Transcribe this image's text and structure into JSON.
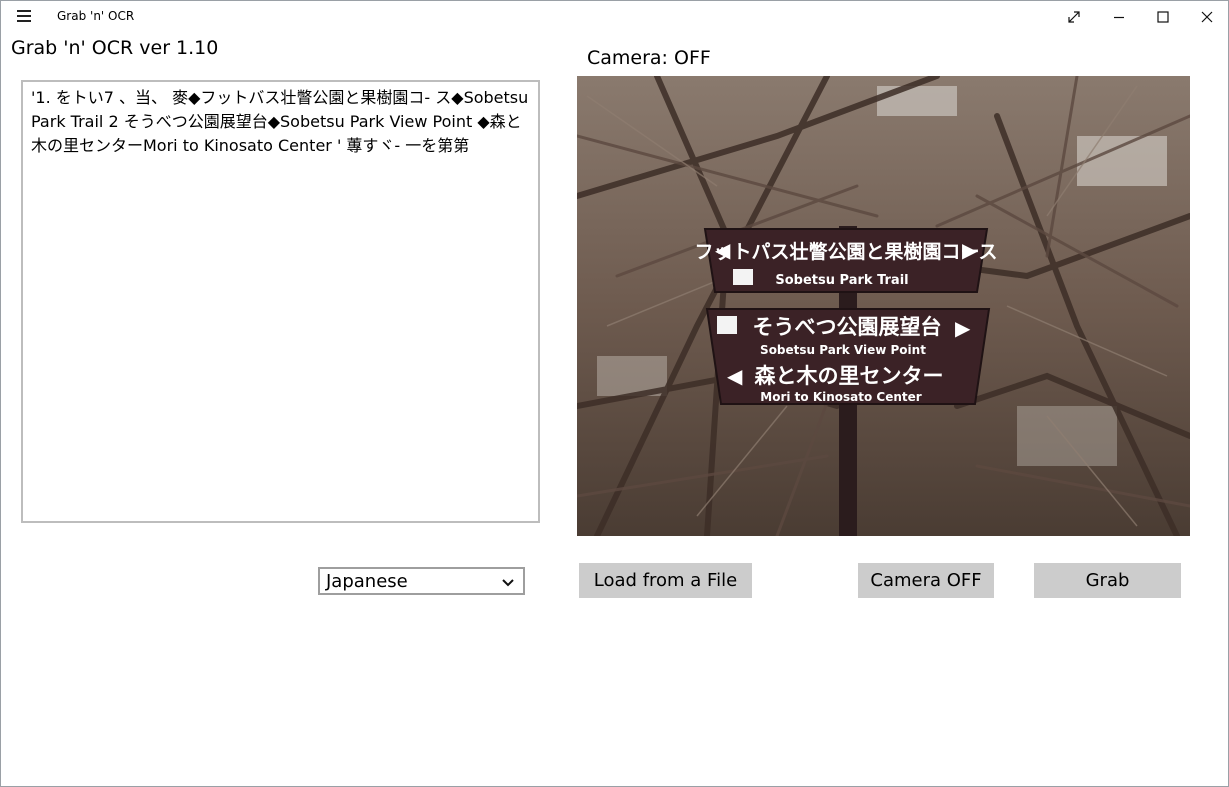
{
  "titlebar": {
    "app_title": "Grab 'n' OCR",
    "menu_icon": "hamburger-icon",
    "expand_icon": "expand-icon",
    "minimize_icon": "minimize-icon",
    "maximize_icon": "maximize-icon",
    "close_icon": "close-icon"
  },
  "main": {
    "version_label": "Grab 'n' OCR ver 1.10",
    "camera_status": "Camera: OFF",
    "ocr_text": "'1. をトい7 、当、 麥◆フットバス壮瞥公園と果樹園コ- ス◆Sobetsu Park Trail 2 そうべつ公園展望台◆Sobetsu Park View Point ◆森と木の里センターMori to Kinosato Center ' 蓴すヾ- 一を第第",
    "language_selected": "Japanese",
    "buttons": {
      "load": "Load from a File",
      "camera": "Camera OFF",
      "grab": "Grab"
    }
  },
  "photo_sign": {
    "line1_jp": "フットパス壮瞥公園と果樹園コース",
    "line1_en": "Sobetsu Park Trail",
    "line2_jp": "そうべつ公園展望台",
    "line2_en": "Sobetsu Park View Point",
    "line3_jp": "森と木の里センター",
    "line3_en": "Mori to Kinosato Center"
  },
  "colors": {
    "button_bg": "#cccccc",
    "sign_bg": "#3b2226",
    "border": "#bdbdbd"
  }
}
